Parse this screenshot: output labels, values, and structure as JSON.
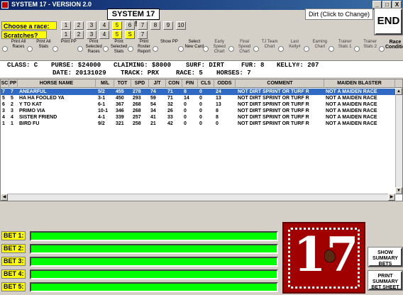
{
  "window": {
    "title": "SYSTEM 17 - VERSION 2.0",
    "min": "_",
    "max": "□",
    "close": "X"
  },
  "banner": "SYSTEM 17 !!!",
  "surface_button": "Dirt (Click to Change)",
  "end_button": "END",
  "race_label": "Choose  a race:",
  "races": [
    "1",
    "2",
    "3",
    "4",
    "5",
    "6",
    "7",
    "8",
    "9",
    "10"
  ],
  "selected_race": "5",
  "scratches_label": "Scratches?",
  "scratches": [
    "1",
    "2",
    "3",
    "4",
    "5",
    "S",
    "7"
  ],
  "scratch_highlight": [
    "5",
    "S"
  ],
  "options": [
    {
      "label": "Print All Races"
    },
    {
      "label": "Print All Stats"
    },
    {
      "label": "Print PP"
    },
    {
      "label": "Print Selected Races"
    },
    {
      "label": "Print Selected Stats"
    },
    {
      "label": "Print Roster Report"
    },
    {
      "label": "Show PP"
    },
    {
      "label": "Select New Card"
    },
    {
      "label": "Early Speed Chart"
    },
    {
      "label": "Final Speed Chart"
    },
    {
      "label": "TJ Team Chart"
    },
    {
      "label": "Last Kelly#"
    },
    {
      "label": "Earning Chart"
    },
    {
      "label": "Trainer Stats 1"
    },
    {
      "label": "Trainer Stats 2"
    },
    {
      "label": "Race Conditions"
    }
  ],
  "race_info": {
    "class": "CLASS: C",
    "purse": "PURSE: $24000",
    "claiming": "CLAIMING: $8000",
    "surf": "SURF: DIRT",
    "fur": "FUR: 8",
    "kelly": "KELLY#: 207",
    "date": "DATE: 20131029",
    "track": "TRACK: PRX",
    "race": "RACE: 5",
    "horses": "HORSES: 7"
  },
  "table": {
    "columns": [
      "SC",
      "PP",
      "HORSE NAME",
      "M/L",
      "TOT",
      "SPD",
      "J/T",
      "CON",
      "FIN",
      "CLS",
      "ODDS",
      "COMMENT",
      "MAIDEN BLASTER"
    ],
    "rows": [
      [
        "7",
        "7",
        "ANEARFUL",
        "5/2",
        "455",
        "278",
        "74",
        "71",
        "8",
        "0",
        "24",
        "NOT DIRT SPRINT OR TURF R",
        "NOT A MAIDEN RACE"
      ],
      [
        "5",
        "5",
        "HA HA FOOLED YA",
        "3-1",
        "450",
        "293",
        "59",
        "71",
        "14",
        "0",
        "13",
        "NOT DIRT SPRINT OR TURF R",
        "NOT A MAIDEN RACE"
      ],
      [
        "6",
        "2",
        "Y TO KAT",
        "6-1",
        "367",
        "268",
        "54",
        "32",
        "0",
        "0",
        "13",
        "NOT DIRT SPRINT OR TURF R",
        "NOT A MAIDEN RACE"
      ],
      [
        "3",
        "3",
        "PRIMO VIA",
        "10-1",
        "346",
        "268",
        "34",
        "26",
        "0",
        "0",
        "8",
        "NOT DIRT SPRINT OR TURF R",
        "NOT A MAIDEN RACE"
      ],
      [
        "4",
        "4",
        "SISTER FRIEND",
        "4-1",
        "339",
        "257",
        "41",
        "33",
        "0",
        "0",
        "8",
        "NOT DIRT SPRINT OR TURF R",
        "NOT A MAIDEN RACE"
      ],
      [
        "1",
        "1",
        "BIRD FU",
        "9/2",
        "321",
        "258",
        "21",
        "42",
        "0",
        "0",
        "0",
        "NOT DIRT SPRINT OR TURF R",
        "NOT A MAIDEN RACE"
      ]
    ]
  },
  "bets": [
    "BET 1:",
    "BET 2:",
    "BET 3:",
    "BET 4:",
    "BET 5:"
  ],
  "logo_number": "17",
  "show_summary": "SHOW SUMMARY BETS",
  "print_summary": "PRINT SUMMARY BET SHEET",
  "colors": {
    "highlight": "#316ac5",
    "bet_field": "#00ff00",
    "label": "#ffff00",
    "logo": "#a00000"
  }
}
